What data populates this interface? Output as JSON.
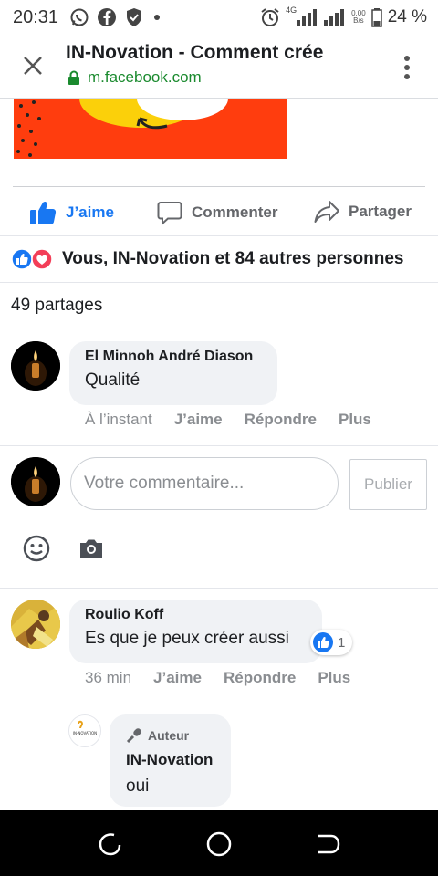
{
  "status_bar": {
    "time": "20:31",
    "network_type": "4G",
    "data_rate_value": "0.00",
    "data_rate_unit": "B/s",
    "battery": "24 %"
  },
  "browser": {
    "title": "IN-Novation - Comment crée",
    "url": "m.facebook.com"
  },
  "post_actions": {
    "like": "J’aime",
    "comment": "Commenter",
    "share": "Partager"
  },
  "reactions_summary": "Vous, IN-Novation et 84 autres personnes",
  "shares": "49 partages",
  "comments": [
    {
      "author": "El Minnoh André Diason",
      "text": "Qualité",
      "time": "À l’instant",
      "like": "J’aime",
      "reply": "Répondre",
      "more": "Plus"
    },
    {
      "author": "Roulio Koff",
      "text": "Es que je peux créer aussi",
      "like_count": "1",
      "time": "36 min",
      "like": "J’aime",
      "reply": "Répondre",
      "more": "Plus"
    }
  ],
  "composer": {
    "placeholder": "Votre commentaire...",
    "publish": "Publier"
  },
  "reply": {
    "badge": "Auteur",
    "author": "IN-Novation",
    "text": "oui",
    "avatar_logo_text": "IN-NOVATION"
  },
  "colors": {
    "facebook_blue": "#1877f2",
    "love_red": "#f33e58",
    "secure_green": "#1a8a2e",
    "post_image_orange": "#ff3d0e",
    "bubble_bg": "#f0f2f5"
  }
}
